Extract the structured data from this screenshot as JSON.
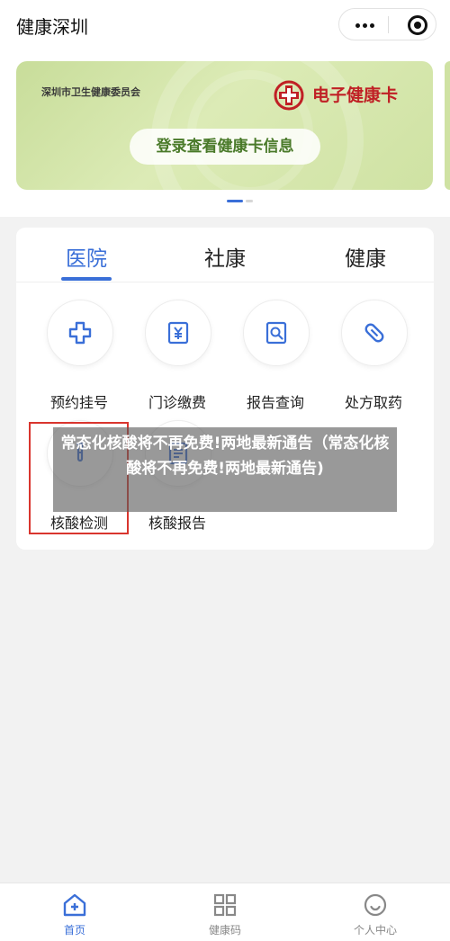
{
  "header": {
    "title": "健康深圳",
    "more_icon": "more-dots-icon",
    "close_icon": "target-circle-icon"
  },
  "banner": {
    "org": "深圳市卫生健康委员会",
    "card_title": "电子健康卡",
    "button": "登录查看健康卡信息",
    "colors": {
      "accent": "#c02025",
      "button_text": "#4a7a2a"
    }
  },
  "tabs": [
    {
      "label": "医院",
      "active": true
    },
    {
      "label": "社康",
      "active": false
    },
    {
      "label": "健康",
      "active": false
    }
  ],
  "services": [
    {
      "label": "预约挂号",
      "icon": "plus-cross-icon"
    },
    {
      "label": "门诊缴费",
      "icon": "yen-receipt-icon"
    },
    {
      "label": "报告查询",
      "icon": "report-search-icon"
    },
    {
      "label": "处方取药",
      "icon": "pill-icon"
    },
    {
      "label": "核酸检测",
      "icon": "test-tube-icon"
    },
    {
      "label": "核酸报告",
      "icon": "document-icon"
    }
  ],
  "overlay": {
    "text": "常态化核酸将不再免费!两地最新通告（常态化核酸将不再免费!两地最新通告)"
  },
  "bottom_nav": [
    {
      "label": "首页",
      "icon": "home-plus-icon",
      "active": true
    },
    {
      "label": "健康码",
      "icon": "qr-grid-icon",
      "active": false
    },
    {
      "label": "个人中心",
      "icon": "smile-user-icon",
      "active": false
    }
  ],
  "colors": {
    "primary": "#3a6fd8",
    "highlight": "#d9352e"
  }
}
